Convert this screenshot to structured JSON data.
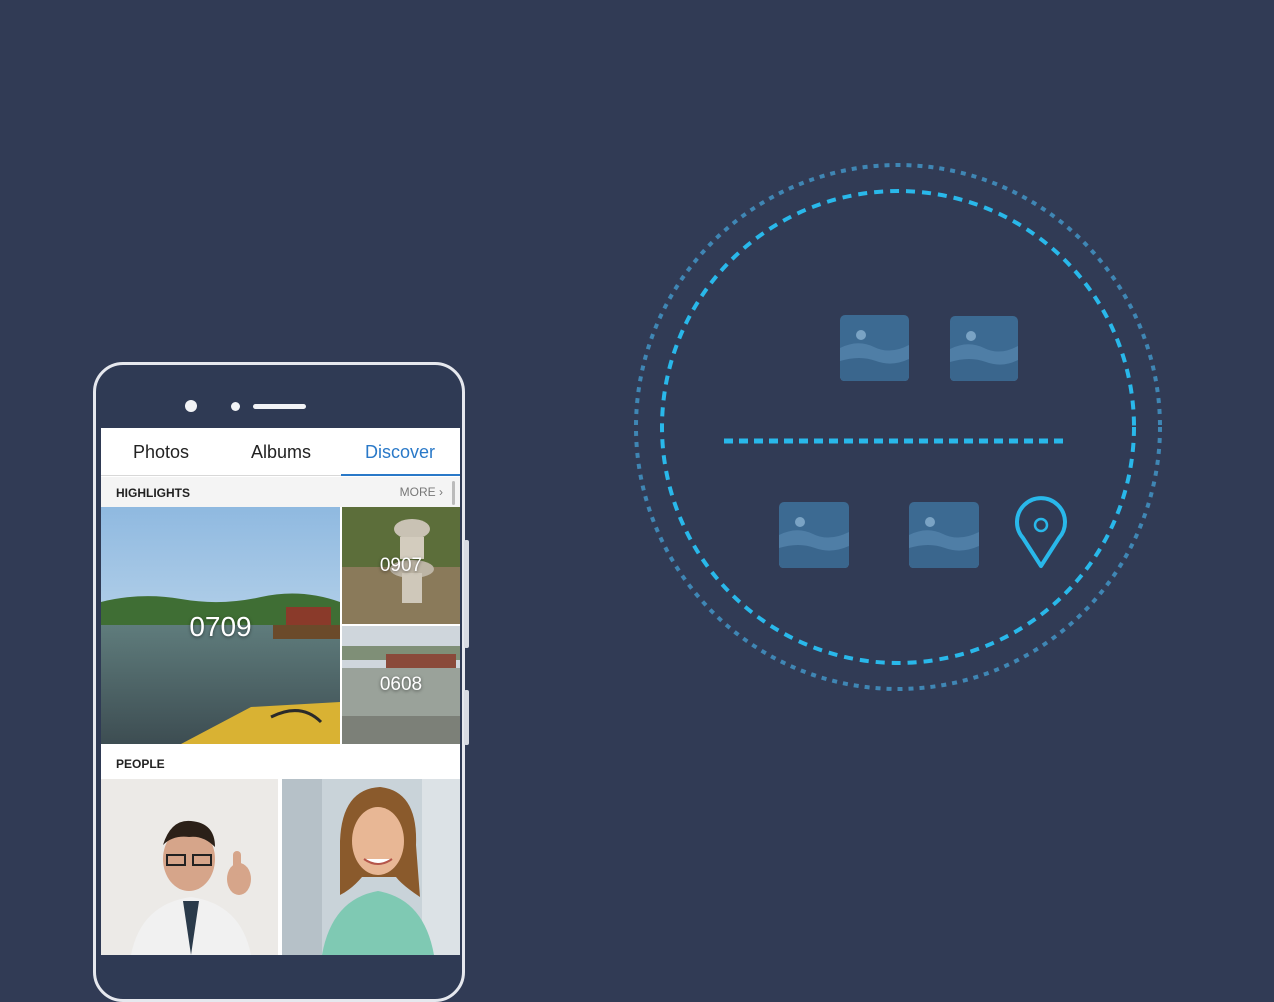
{
  "tabs": [
    {
      "label": "Photos",
      "active": false
    },
    {
      "label": "Albums",
      "active": false
    },
    {
      "label": "Discover",
      "active": true
    }
  ],
  "highlights": {
    "title": "HIGHLIGHTS",
    "more_label": "MORE",
    "items": [
      {
        "label": "0709"
      },
      {
        "label": "0907"
      },
      {
        "label": "0608"
      }
    ]
  },
  "people": {
    "title": "PEOPLE"
  },
  "colors": {
    "background": "#313b55",
    "accent": "#2a79c8",
    "ring": "#29b8ea",
    "ring_outer": "#3f86b4",
    "image_tile": "#3c6a92"
  },
  "icons": [
    "image-icon",
    "location-pin-icon",
    "chevron-right-icon"
  ]
}
